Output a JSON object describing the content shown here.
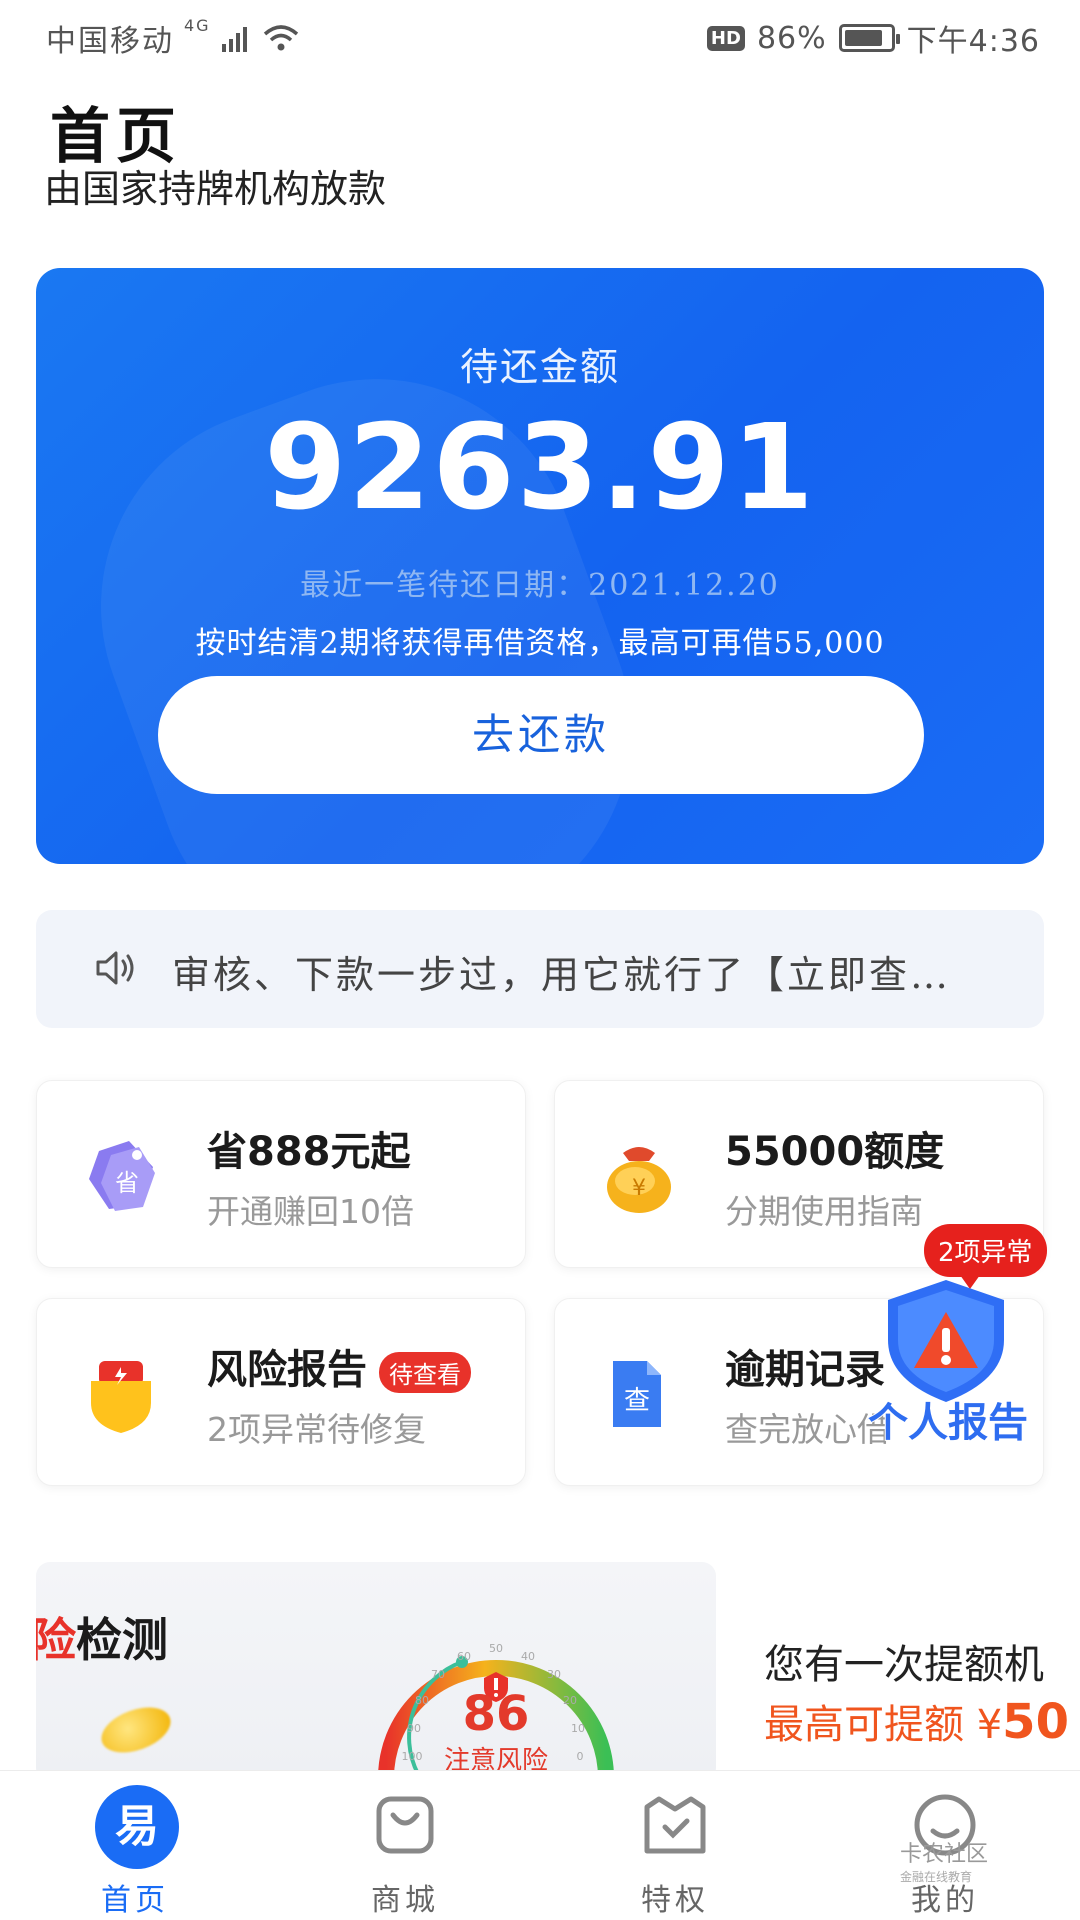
{
  "status_bar": {
    "carrier": "中国移动",
    "network": "4G",
    "hd": "HD",
    "battery": "86%",
    "battery_level": 0.86,
    "time": "下午4:36"
  },
  "header": {
    "title": "首页",
    "subtitle": "由国家持牌机构放款"
  },
  "repay_card": {
    "label": "待还金额",
    "amount": "9263.91",
    "due_date": "最近一笔待还日期：2021.12.20",
    "notice": "按时结清2期将获得再借资格，最高可再借55,000",
    "button": "去还款"
  },
  "announcement": {
    "icon": "speaker-icon",
    "text": "审核、下款一步过，用它就行了【立即查…"
  },
  "features": [
    {
      "icon": "discount-tag-icon",
      "icon_char": "省",
      "title": "省888元起",
      "subtitle": "开通赚回10倍"
    },
    {
      "icon": "money-bag-icon",
      "icon_char": "¥",
      "title": "55000额度",
      "subtitle": "分期使用指南"
    },
    {
      "icon": "risk-shield-icon",
      "title": "风险报告",
      "badge": "待查看",
      "subtitle": "2项异常待修复"
    },
    {
      "icon": "document-check-icon",
      "icon_char": "查",
      "title": "逾期记录",
      "subtitle": "查完放心借"
    }
  ],
  "float_widget": {
    "bubble": "2项异常",
    "label": "个人报告",
    "icon": "warning-shield-icon"
  },
  "promo": {
    "left_title_highlight": "险",
    "left_title": "检测",
    "score": "86",
    "risk_label": "注意风险",
    "gauge_ticks": [
      "50",
      "40",
      "30",
      "20",
      "10",
      "0",
      "60",
      "70",
      "80",
      "90",
      "100"
    ],
    "right_line1": "您有一次提额机",
    "right_line2_prefix": "最高可提额 ¥",
    "right_line2_amount": "50"
  },
  "tabbar": {
    "tabs": [
      {
        "label": "首页",
        "icon": "home-icon",
        "icon_char": "易",
        "active": true
      },
      {
        "label": "商城",
        "icon": "shopping-bag-icon",
        "active": false
      },
      {
        "label": "特权",
        "icon": "privilege-bag-icon",
        "active": false
      },
      {
        "label": "我的",
        "icon": "profile-icon",
        "active": false
      }
    ]
  },
  "watermark": {
    "main": "卡农社区",
    "sub": "金融在线教育"
  },
  "colors": {
    "primary": "#1a6cf5",
    "alert": "#e8322a",
    "promo_orange": "#f0551e"
  }
}
